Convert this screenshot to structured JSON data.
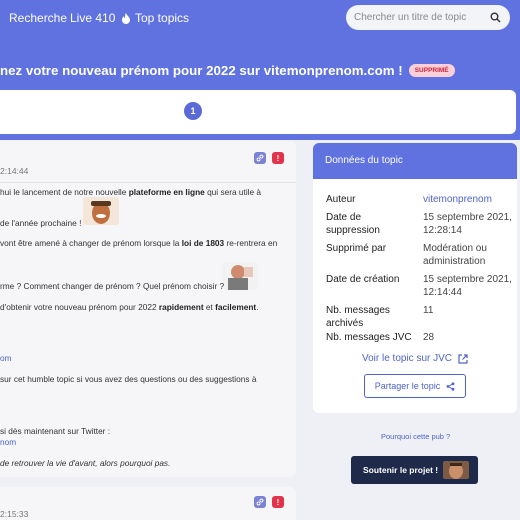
{
  "nav": {
    "items": [
      "Recherche",
      "Live 410",
      "Top topics"
    ]
  },
  "search": {
    "placeholder": "Chercher un titre de topic"
  },
  "topic": {
    "title": "nez votre nouveau prénom pour 2022 sur vitemonprenom.com !",
    "badge": "SUPPRIMÉ"
  },
  "pagination": {
    "current": "1"
  },
  "post1": {
    "date": "2:14:44",
    "lines": [
      {
        "pre": "hui le lancement de notre nouvelle ",
        "bold": "plateforme en ligne",
        "post": " qui sera utile à"
      },
      {
        "text": " de l'année prochaine !"
      },
      {
        "pre": "vont être amené à changer de prénom lorsque la ",
        "bold": "loi de 1803",
        "post": " re-rentrera en"
      },
      {
        "text": "rme ? Comment changer de prénom ? Quel prénom choisir ?"
      },
      {
        "pre": "d'obtenir votre nouveau prénom pour 2022 ",
        "bold": "rapidement",
        "mid": " et ",
        "bold2": "facilement",
        "post": "."
      },
      {
        "link": "om"
      },
      {
        "text": " sur cet humble topic si vous avez des questions ou des suggestions à"
      },
      {
        "text": "si dès maintenant sur Twitter :"
      },
      {
        "link": "nom"
      },
      {
        "italic": "de retrouver la vie d'avant, alors pourquoi pas."
      }
    ]
  },
  "post2": {
    "date": "2:15:33"
  },
  "sidebar": {
    "heading": "Données du topic",
    "rows": [
      {
        "label": "Auteur",
        "value": "vitemonprenom"
      },
      {
        "label": "Date de suppression",
        "value": "15 septembre 2021, 12:28:14"
      },
      {
        "label": "Supprimé par",
        "value": "Modération ou administration"
      },
      {
        "label": "Date de création",
        "value": "15 septembre 2021, 12:14:44"
      },
      {
        "label": "Nb. messages archivés",
        "value": "11"
      },
      {
        "label": "Nb. messages JVC",
        "value": "28"
      }
    ],
    "see_topic": "Voir le topic sur JVC",
    "share": "Partager le topic"
  },
  "ad": {
    "why": "Pourquoi cette pub ?",
    "support": "Soutenir le projet !"
  },
  "colors": {
    "header": "#5f72e0",
    "accent": "#4f63c9",
    "danger": "#e2334b",
    "dark_button": "#1f2a4a"
  },
  "icons": [
    "fire-icon",
    "search-icon",
    "link-icon",
    "alert-icon",
    "external-link-icon",
    "share-icon"
  ]
}
